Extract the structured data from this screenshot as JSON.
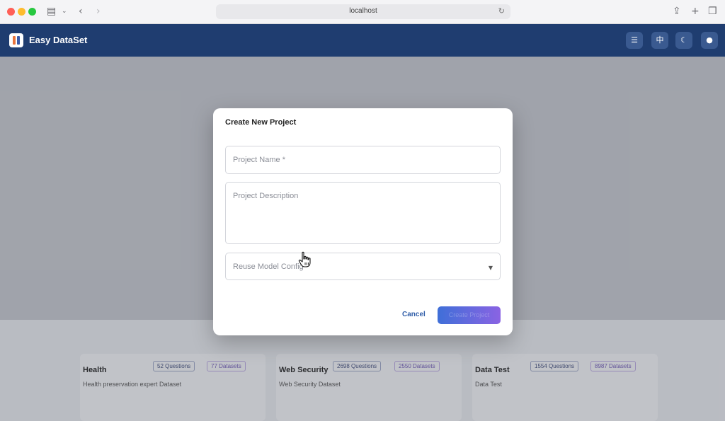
{
  "browser": {
    "url": "localhost"
  },
  "app": {
    "title": "Easy DataSet",
    "header_buttons": [
      {
        "name": "list-icon",
        "glyph": "☰"
      },
      {
        "name": "language-icon",
        "glyph": "中"
      },
      {
        "name": "moon-icon",
        "glyph": "☾"
      },
      {
        "name": "github-icon",
        "glyph": "●"
      }
    ]
  },
  "dialog": {
    "title": "Create New Project",
    "project_name_placeholder": "Project Name *",
    "project_description_placeholder": "Project Description",
    "reuse_model_placeholder": "Reuse Model Config",
    "cancel_label": "Cancel",
    "create_label": "Create Project"
  },
  "projects": [
    {
      "title": "Health",
      "description": "Health preservation expert Dataset",
      "questions": "52 Questions",
      "datasets": "77 Datasets"
    },
    {
      "title": "Web Security",
      "description": "Web Security Dataset",
      "questions": "2698 Questions",
      "datasets": "2550 Datasets"
    },
    {
      "title": "Data Test",
      "description": "Data Test",
      "questions": "1554 Questions",
      "datasets": "8987 Datasets"
    }
  ]
}
